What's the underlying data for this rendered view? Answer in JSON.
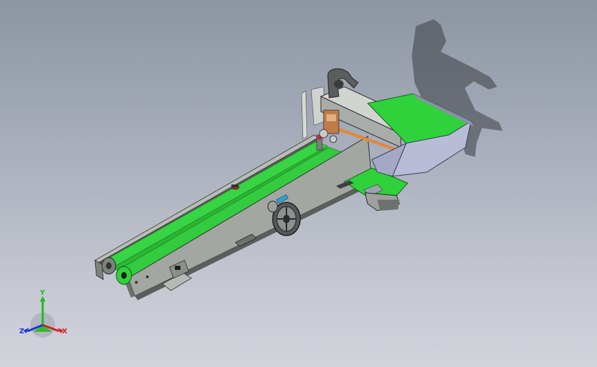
{
  "viewport": {
    "background_top": "#8d95a3",
    "background_bottom": "#d2d4dc"
  },
  "model": {
    "belt_color": "#2fd23a",
    "frame_color": "#a7aba6",
    "dark_color": "#4a4d4c",
    "hopper_color": "#b9bcd6",
    "rail_accent": "#e0893a"
  },
  "triad": {
    "x_label": "X",
    "y_label": "Y",
    "z_label": "Z",
    "x_color": "#d22020",
    "y_color": "#1fb81f",
    "z_color": "#1a33d6"
  }
}
